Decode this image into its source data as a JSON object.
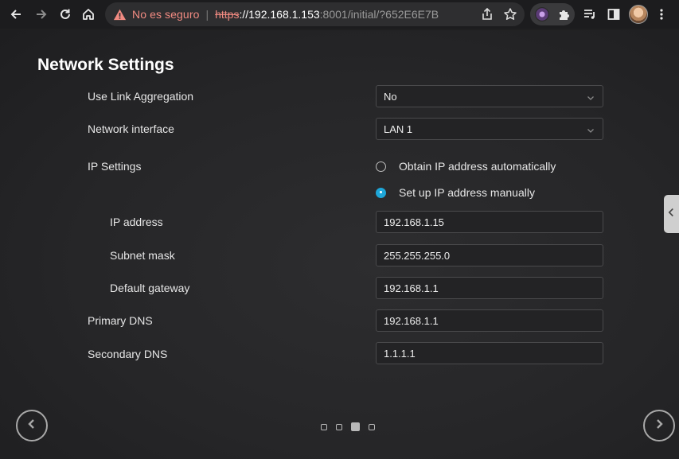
{
  "browser": {
    "security_label": "No es seguro",
    "url_scheme": "https",
    "url_host": "://192.168.1.153",
    "url_rest": ":8001/initial/?652E6E7B"
  },
  "page": {
    "title": "Network Settings",
    "fields": {
      "link_aggregation": {
        "label": "Use Link Aggregation",
        "value": "No"
      },
      "network_interface": {
        "label": "Network interface",
        "value": "LAN 1"
      },
      "ip_settings": {
        "label": "IP Settings",
        "option_auto": "Obtain IP address automatically",
        "option_manual": "Set up IP address manually",
        "selected": "manual"
      },
      "ip_address": {
        "label": "IP address",
        "value": "192.168.1.15"
      },
      "subnet_mask": {
        "label": "Subnet mask",
        "value": "255.255.255.0"
      },
      "default_gateway": {
        "label": "Default gateway",
        "value": "192.168.1.1"
      },
      "primary_dns": {
        "label": "Primary DNS",
        "value": "192.168.1.1"
      },
      "secondary_dns": {
        "label": "Secondary DNS",
        "value": "1.1.1.1"
      }
    },
    "pager": {
      "total": 4,
      "current": 3
    }
  },
  "colors": {
    "accent": "#1ea6d8",
    "warning": "#f28b82",
    "background": "#262628"
  },
  "icons": [
    "back-arrow-icon",
    "forward-arrow-icon",
    "reload-icon",
    "home-icon",
    "warning-icon",
    "share-icon",
    "star-icon",
    "extension-puzzle-icon",
    "media-queue-icon",
    "side-panel-icon",
    "kebab-menu-icon",
    "chevron-down-icon",
    "chevron-left-icon",
    "chevron-right-icon"
  ]
}
